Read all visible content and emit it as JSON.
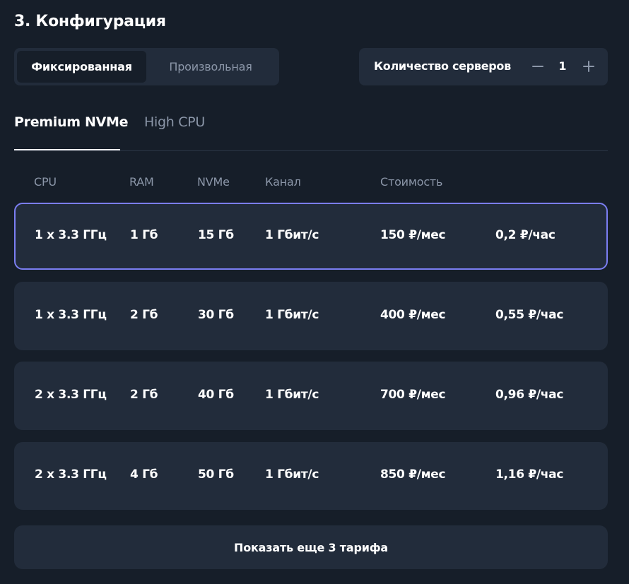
{
  "section": {
    "title": "3. Конфигурация"
  },
  "mode_toggle": {
    "options": [
      "Фиксированная",
      "Произвольная"
    ],
    "selected": "Фиксированная"
  },
  "servers": {
    "label": "Количество серверов",
    "minus_icon": "minus-icon",
    "plus_icon": "plus-icon",
    "value": "1"
  },
  "tabs": {
    "items": [
      "Premium NVMe",
      "High CPU"
    ],
    "active": "Premium NVMe"
  },
  "table": {
    "columns": [
      "CPU",
      "RAM",
      "NVMe",
      "Канал",
      "Стоимость"
    ],
    "rows": [
      {
        "cpu": "1 x 3.3 ГГц",
        "ram": "1 Гб",
        "nvme": "15 Гб",
        "channel": "1 Гбит/с",
        "price_month": "150 ₽/мес",
        "price_hour": "0,2 ₽/час",
        "selected": true
      },
      {
        "cpu": "1 x 3.3 ГГц",
        "ram": "2 Гб",
        "nvme": "30 Гб",
        "channel": "1 Гбит/с",
        "price_month": "400 ₽/мес",
        "price_hour": "0,55 ₽/час",
        "selected": false
      },
      {
        "cpu": "2 x 3.3 ГГц",
        "ram": "2 Гб",
        "nvme": "40 Гб",
        "channel": "1 Гбит/с",
        "price_month": "700 ₽/мес",
        "price_hour": "0,96 ₽/час",
        "selected": false
      },
      {
        "cpu": "2 x 3.3 ГГц",
        "ram": "4 Гб",
        "nvme": "50 Гб",
        "channel": "1 Гбит/с",
        "price_month": "850 ₽/мес",
        "price_hour": "1,16 ₽/час",
        "selected": false
      }
    ]
  },
  "show_more": {
    "label": "Показать еще 3 тарифа"
  },
  "colors": {
    "background": "#161e29",
    "card": "#222c3b",
    "accent_border": "#7b7ef2",
    "muted_text": "#8b96a8",
    "text": "#ffffff"
  }
}
